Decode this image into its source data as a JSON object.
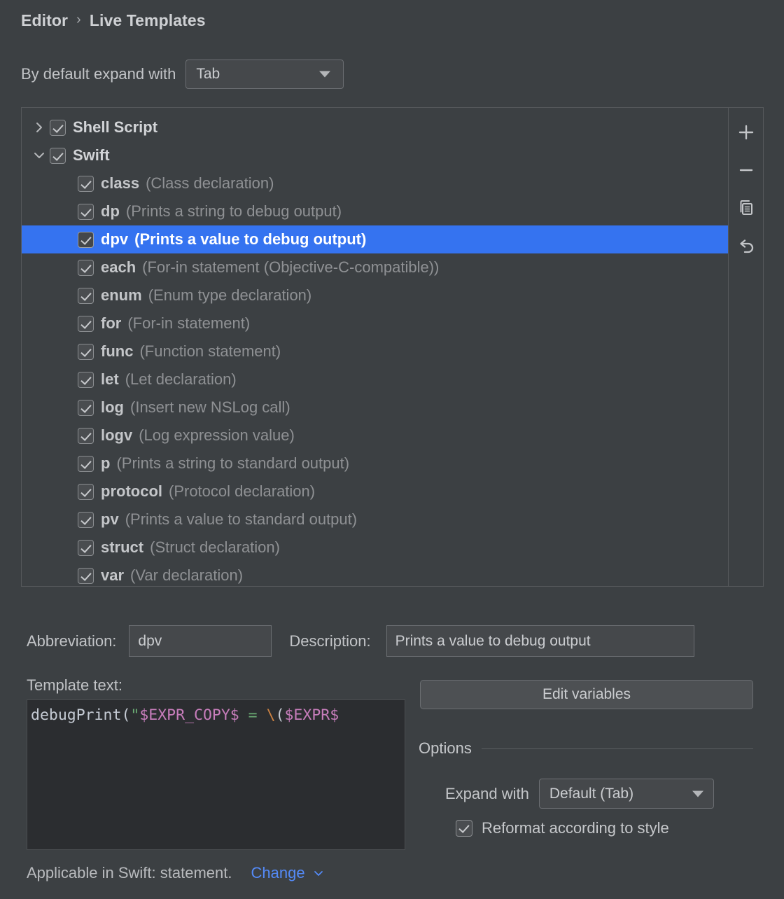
{
  "breadcrumb": {
    "root": "Editor",
    "separator": "›",
    "current": "Live Templates"
  },
  "expand_default": {
    "label": "By default expand with",
    "value": "Tab"
  },
  "tree": {
    "rows": [
      {
        "type": "group",
        "chevron": "chevron-right-icon",
        "checked": true,
        "name": "Shell Script",
        "expanded": false
      },
      {
        "type": "group",
        "chevron": "chevron-down-icon",
        "checked": true,
        "name": "Swift",
        "expanded": true
      },
      {
        "type": "item",
        "checked": true,
        "abbr": "class",
        "desc": "(Class declaration)",
        "selected": false
      },
      {
        "type": "item",
        "checked": true,
        "abbr": "dp",
        "desc": "(Prints a string to debug output)",
        "selected": false
      },
      {
        "type": "item",
        "checked": true,
        "abbr": "dpv",
        "desc": "(Prints a value to debug output)",
        "selected": true
      },
      {
        "type": "item",
        "checked": true,
        "abbr": "each",
        "desc": "(For-in statement (Objective-C-compatible))",
        "selected": false
      },
      {
        "type": "item",
        "checked": true,
        "abbr": "enum",
        "desc": "(Enum type declaration)",
        "selected": false
      },
      {
        "type": "item",
        "checked": true,
        "abbr": "for",
        "desc": "(For-in statement)",
        "selected": false
      },
      {
        "type": "item",
        "checked": true,
        "abbr": "func",
        "desc": "(Function statement)",
        "selected": false
      },
      {
        "type": "item",
        "checked": true,
        "abbr": "let",
        "desc": "(Let declaration)",
        "selected": false
      },
      {
        "type": "item",
        "checked": true,
        "abbr": "log",
        "desc": "(Insert new NSLog call)",
        "selected": false
      },
      {
        "type": "item",
        "checked": true,
        "abbr": "logv",
        "desc": "(Log expression value)",
        "selected": false
      },
      {
        "type": "item",
        "checked": true,
        "abbr": "p",
        "desc": "(Prints a string to standard output)",
        "selected": false
      },
      {
        "type": "item",
        "checked": true,
        "abbr": "protocol",
        "desc": "(Protocol declaration)",
        "selected": false
      },
      {
        "type": "item",
        "checked": true,
        "abbr": "pv",
        "desc": "(Prints a value to standard output)",
        "selected": false
      },
      {
        "type": "item",
        "checked": true,
        "abbr": "struct",
        "desc": "(Struct declaration)",
        "selected": false
      },
      {
        "type": "item",
        "checked": true,
        "abbr": "var",
        "desc": "(Var declaration)",
        "selected": false
      }
    ]
  },
  "toolbar": {
    "buttons": [
      {
        "icon": "plus-icon",
        "name": "add-template-button"
      },
      {
        "icon": "minus-icon",
        "name": "remove-template-button"
      },
      {
        "icon": "copy-icon",
        "name": "duplicate-template-button"
      },
      {
        "icon": "undo-icon",
        "name": "revert-template-button"
      }
    ]
  },
  "details": {
    "abbreviation_label": "Abbreviation:",
    "abbreviation_value": "dpv",
    "description_label": "Description:",
    "description_value": "Prints a value to debug output",
    "template_text_label": "Template text:",
    "template_code": {
      "tokens": [
        {
          "t": "debugPrint(",
          "c": "plain"
        },
        {
          "t": "\"",
          "c": "str"
        },
        {
          "t": "$EXPR_COPY$",
          "c": "var"
        },
        {
          "t": " = ",
          "c": "str"
        },
        {
          "t": "\\",
          "c": "esc"
        },
        {
          "t": "(",
          "c": "plain"
        },
        {
          "t": "$EXPR$",
          "c": "var"
        }
      ]
    }
  },
  "right_panel": {
    "edit_variables_label": "Edit variables",
    "options_title": "Options",
    "expand_with_label": "Expand with",
    "expand_with_value": "Default (Tab)",
    "reformat_label": "Reformat according to style",
    "reformat_checked": true
  },
  "footer": {
    "applicable_text": "Applicable in Swift: statement.",
    "change_link": "Change"
  },
  "colors": {
    "selection_blue": "#3573f0",
    "link_blue": "#548af7",
    "panel_bg": "#3c4043",
    "editor_bg": "#2b2d30",
    "string_green": "#6aab73",
    "variable_pink": "#c77dbb",
    "escape_orange": "#cc8242"
  }
}
